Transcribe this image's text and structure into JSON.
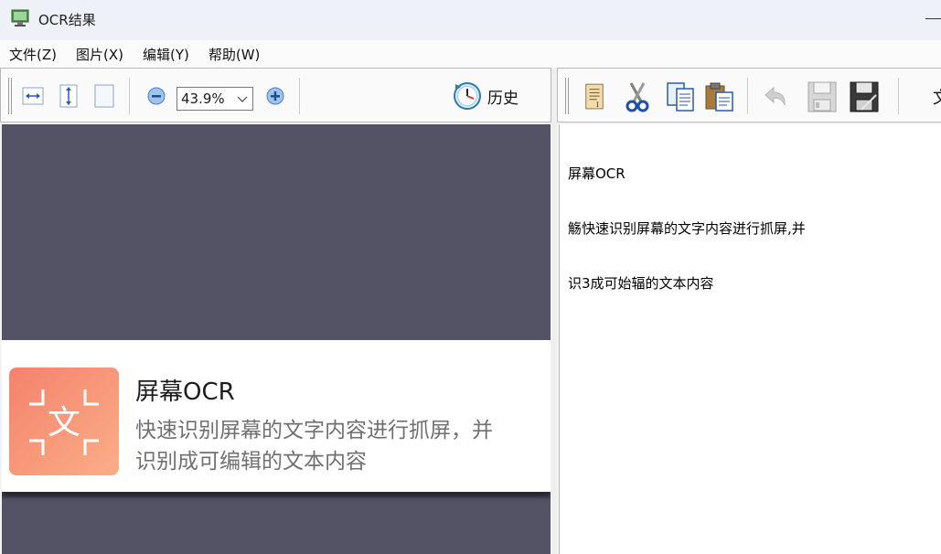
{
  "window": {
    "title": "OCR结果"
  },
  "menu": {
    "items": [
      "文件(Z)",
      "图片(X)",
      "编辑(Y)",
      "帮助(W)"
    ]
  },
  "image_toolbar": {
    "zoom_value": "43.9%",
    "history_label": "历史",
    "icons": [
      "fit-width-icon",
      "fit-height-icon",
      "actual-size-icon",
      "zoom-out-icon",
      "zoom-in-icon",
      "history-clock-icon"
    ]
  },
  "preview": {
    "card_title": "屏幕OCR",
    "card_desc_line1": "快速识别屏幕的文字内容进行抓屏，并",
    "card_desc_line2": "识别成可编辑的文本内容",
    "card_icon_glyph": "文",
    "colors": {
      "background": "#545366",
      "icon_from": "#f4826c",
      "icon_to": "#fbae86"
    }
  },
  "text_toolbar": {
    "icons": [
      "format-icon",
      "cut-icon",
      "copy-icon",
      "paste-icon",
      "undo-icon",
      "save-icon",
      "save-as-icon"
    ],
    "partial_label": "文"
  },
  "ocr_text": {
    "lines": [
      "屏幕OCR",
      "觞快速识别屏幕的文字内容迸行抓屏,并",
      "识3成可始辐的文本内容"
    ]
  }
}
